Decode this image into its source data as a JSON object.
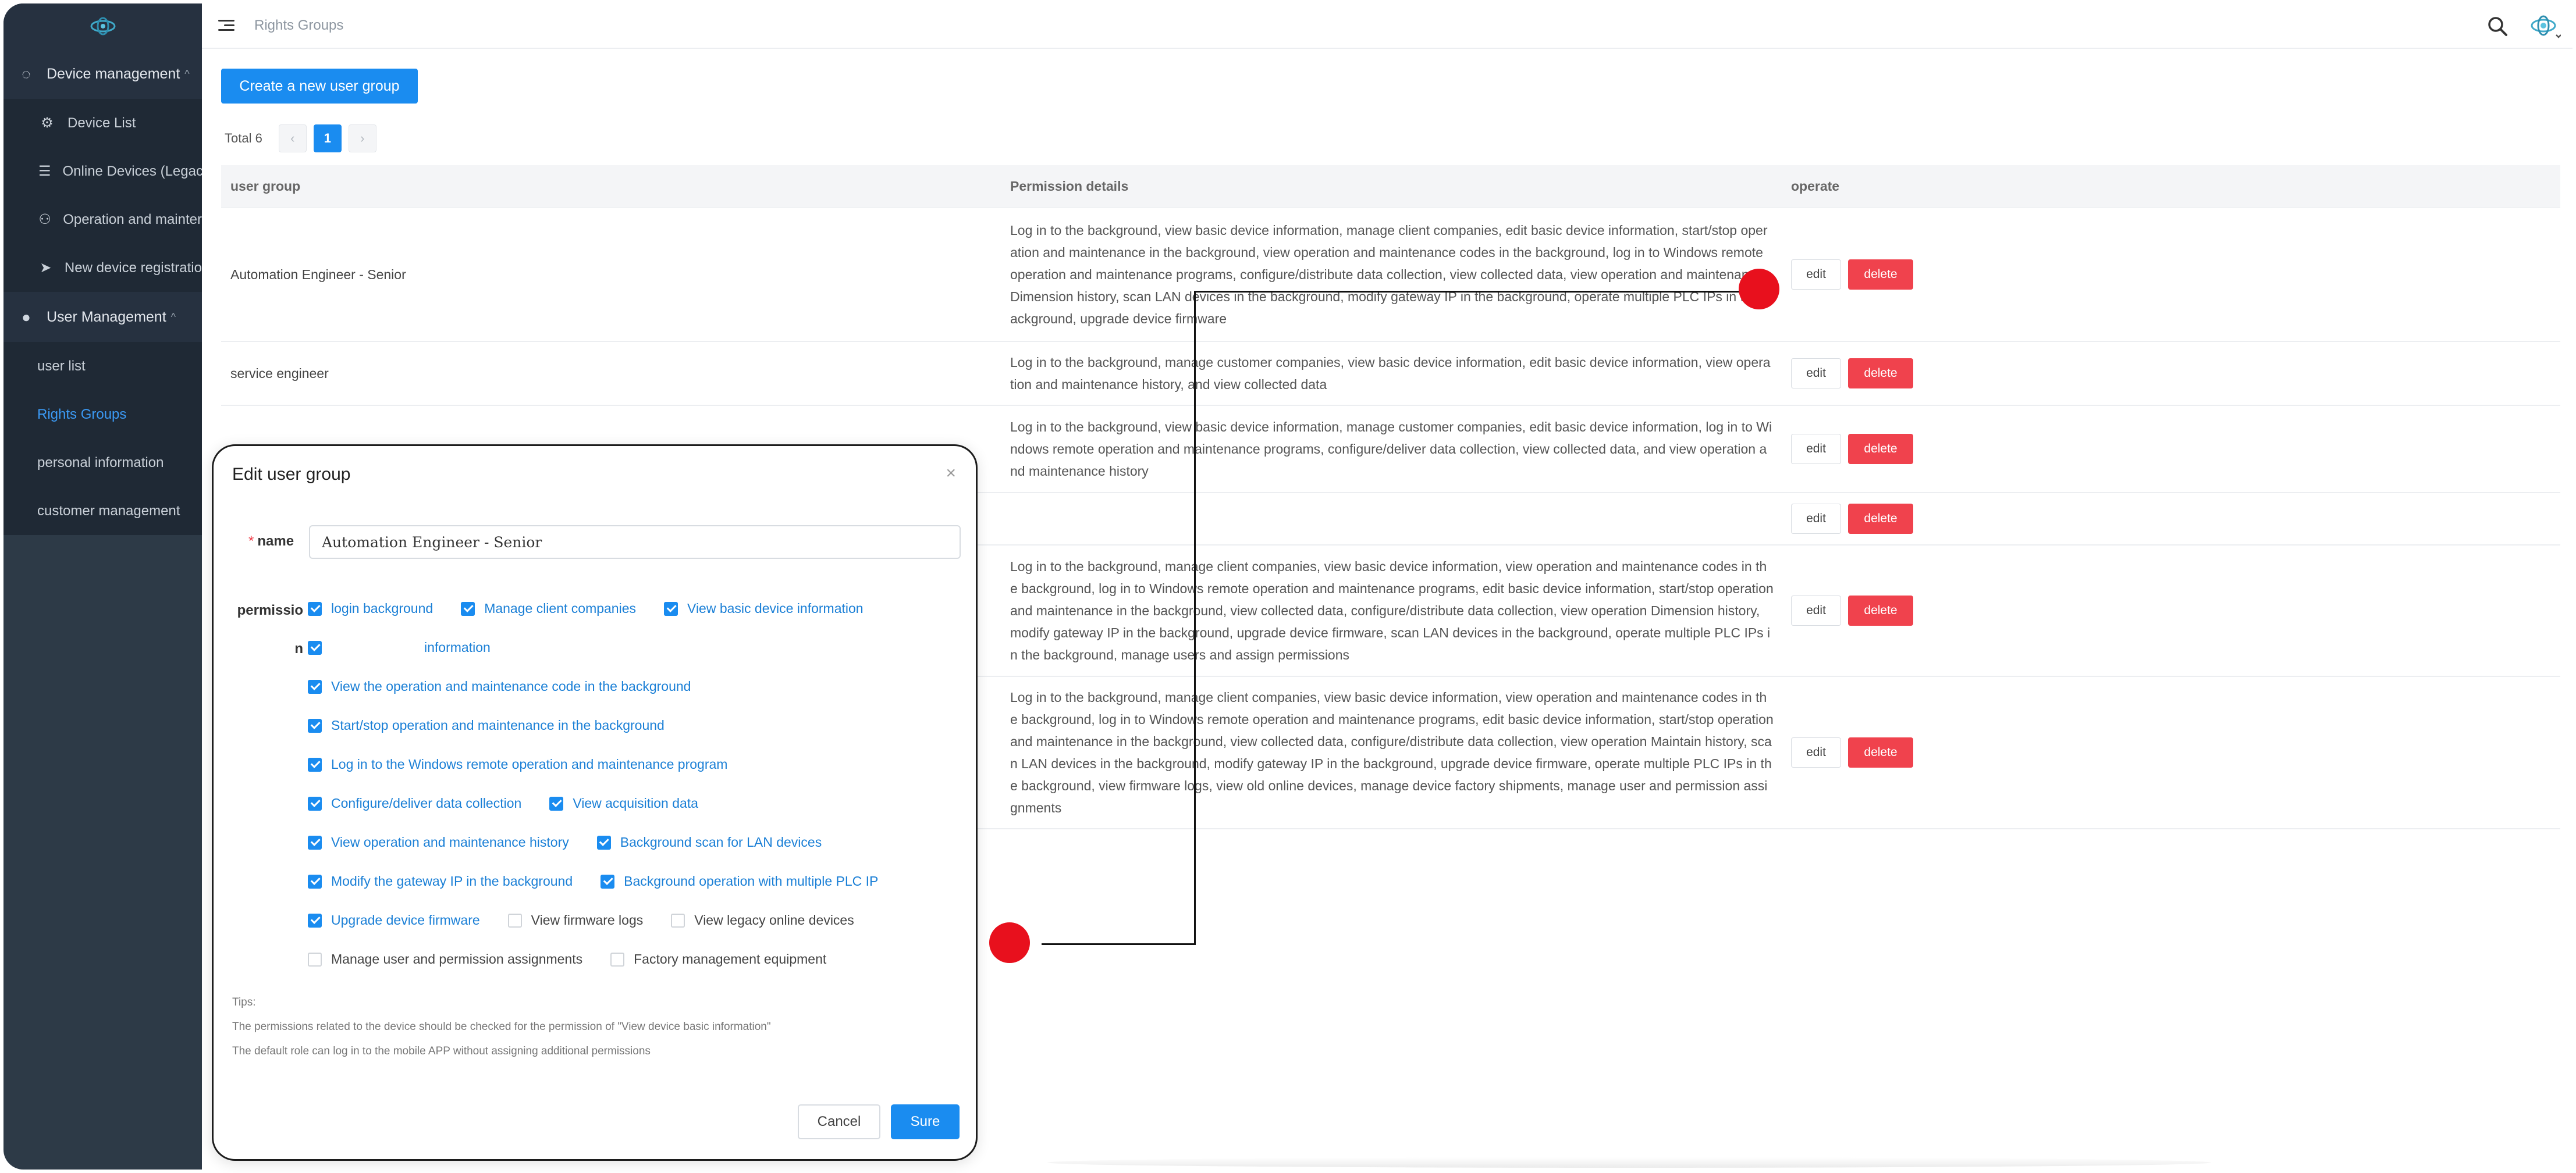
{
  "sidebar": {
    "groups": [
      {
        "title": "Device management",
        "icon": "chip-icon",
        "items": [
          {
            "label": "Device List",
            "icon": "chip-icon"
          },
          {
            "label": "Online Devices (Legac",
            "icon": "list-icon"
          },
          {
            "label": "Operation and mainter",
            "icon": "hierarchy-icon"
          },
          {
            "label": "New device registratio",
            "icon": "send-icon"
          }
        ]
      },
      {
        "title": "User Management",
        "icon": "user-icon",
        "items": [
          {
            "label": "user list"
          },
          {
            "label": "Rights Groups"
          },
          {
            "label": "personal information"
          },
          {
            "label": "customer management"
          }
        ]
      }
    ]
  },
  "header": {
    "breadcrumb": "Rights Groups"
  },
  "toolbar": {
    "create_label": "Create a new user group"
  },
  "pagination": {
    "total": "Total 6",
    "prev": "‹",
    "current": "1",
    "next": "›"
  },
  "table": {
    "headers": [
      "user group",
      "Permission details",
      "operate"
    ],
    "edit_label": "edit",
    "delete_label": "delete",
    "rows": [
      {
        "group": "Automation Engineer - Senior",
        "details": "Log in to the background, view basic device information, manage client companies, edit basic device information, start/stop operation and maintenance in the background, view operation and maintenance codes in the background, log in to Windows remote operation and maintenance programs, configure/distribute data collection, view collected data, view operation and maintenance Dimension history, scan LAN devices in the background, modify gateway IP in the background, operate multiple PLC IPs in the background, upgrade device firmware"
      },
      {
        "group": "service engineer",
        "details": "Log in to the background, manage customer companies, view basic device information, edit basic device information, view operation and maintenance history, and view collected data"
      },
      {
        "group": "",
        "details": "Log in to the background, view basic device information, manage customer companies, edit basic device information, log in to Windows remote operation and maintenance programs, configure/deliver data collection, view collected data, and view operation and maintenance history"
      },
      {
        "group": "",
        "details": ""
      },
      {
        "group": "",
        "details": "Log in to the background, manage client companies, view basic device information, view operation and maintenance codes in the background, log in to Windows remote operation and maintenance programs, edit basic device information, start/stop operation and maintenance in the background, view collected data, configure/distribute data collection, view operation Dimension history, modify gateway IP in the background, upgrade device firmware, scan LAN devices in the background, operate multiple PLC IPs in the background, manage users and assign permissions"
      },
      {
        "group": "",
        "details": "Log in to the background, manage client companies, view basic device information, view operation and maintenance codes in the background, log in to Windows remote operation and maintenance programs, edit basic device information, start/stop operation and maintenance in the background, view collected data, configure/distribute data collection, view operation Maintain history, scan LAN devices in the background, modify gateway IP in the background, upgrade device firmware, operate multiple PLC IPs in the background, view firmware logs, view old online devices, manage device factory shipments, manage user and permission assignments"
      }
    ]
  },
  "modal": {
    "title": "Edit user group",
    "close": "×",
    "name_label": "name",
    "name_value": "Automation Engineer - Senior",
    "perm_label": "permission",
    "permission_rows": [
      [
        {
          "label": "login background",
          "checked": true
        },
        {
          "label": "Manage client companies",
          "checked": true
        },
        {
          "label": "View basic device information",
          "checked": true
        }
      ],
      [
        {
          "label": "information",
          "checked": true,
          "masked": true
        }
      ],
      [
        {
          "label": "View the operation and maintenance code in the background",
          "checked": true
        }
      ],
      [
        {
          "label": "Start/stop operation and maintenance in the background",
          "checked": true
        }
      ],
      [
        {
          "label": "Log in to the Windows remote operation and maintenance program",
          "checked": true
        }
      ],
      [
        {
          "label": "Configure/deliver data collection",
          "checked": true
        },
        {
          "label": "View acquisition data",
          "checked": true
        }
      ],
      [
        {
          "label": "View operation and maintenance history",
          "checked": true
        },
        {
          "label": "Background scan for LAN devices",
          "checked": true
        }
      ],
      [
        {
          "label": "Modify the gateway IP in the background",
          "checked": true
        },
        {
          "label": "Background operation with multiple PLC IP",
          "checked": true
        }
      ],
      [
        {
          "label": "Upgrade device firmware",
          "checked": true
        },
        {
          "label": "View firmware logs",
          "checked": false
        },
        {
          "label": "View legacy online devices",
          "checked": false
        }
      ],
      [
        {
          "label": "Manage user and permission assignments",
          "checked": false
        },
        {
          "label": "Factory management equipment",
          "checked": false
        }
      ]
    ],
    "tips_title": "Tips:",
    "tips": [
      "The permissions related to the device should be checked for the permission of \"View device basic information\"",
      "The default role can log in to the mobile APP without assigning additional permissions"
    ],
    "cancel_label": "Cancel",
    "sure_label": "Sure"
  },
  "colors": {
    "accent": "#1a8cf0",
    "danger": "#f0424d",
    "sidebar_bg": "#2d3a47",
    "annotation": "#e8101d"
  }
}
